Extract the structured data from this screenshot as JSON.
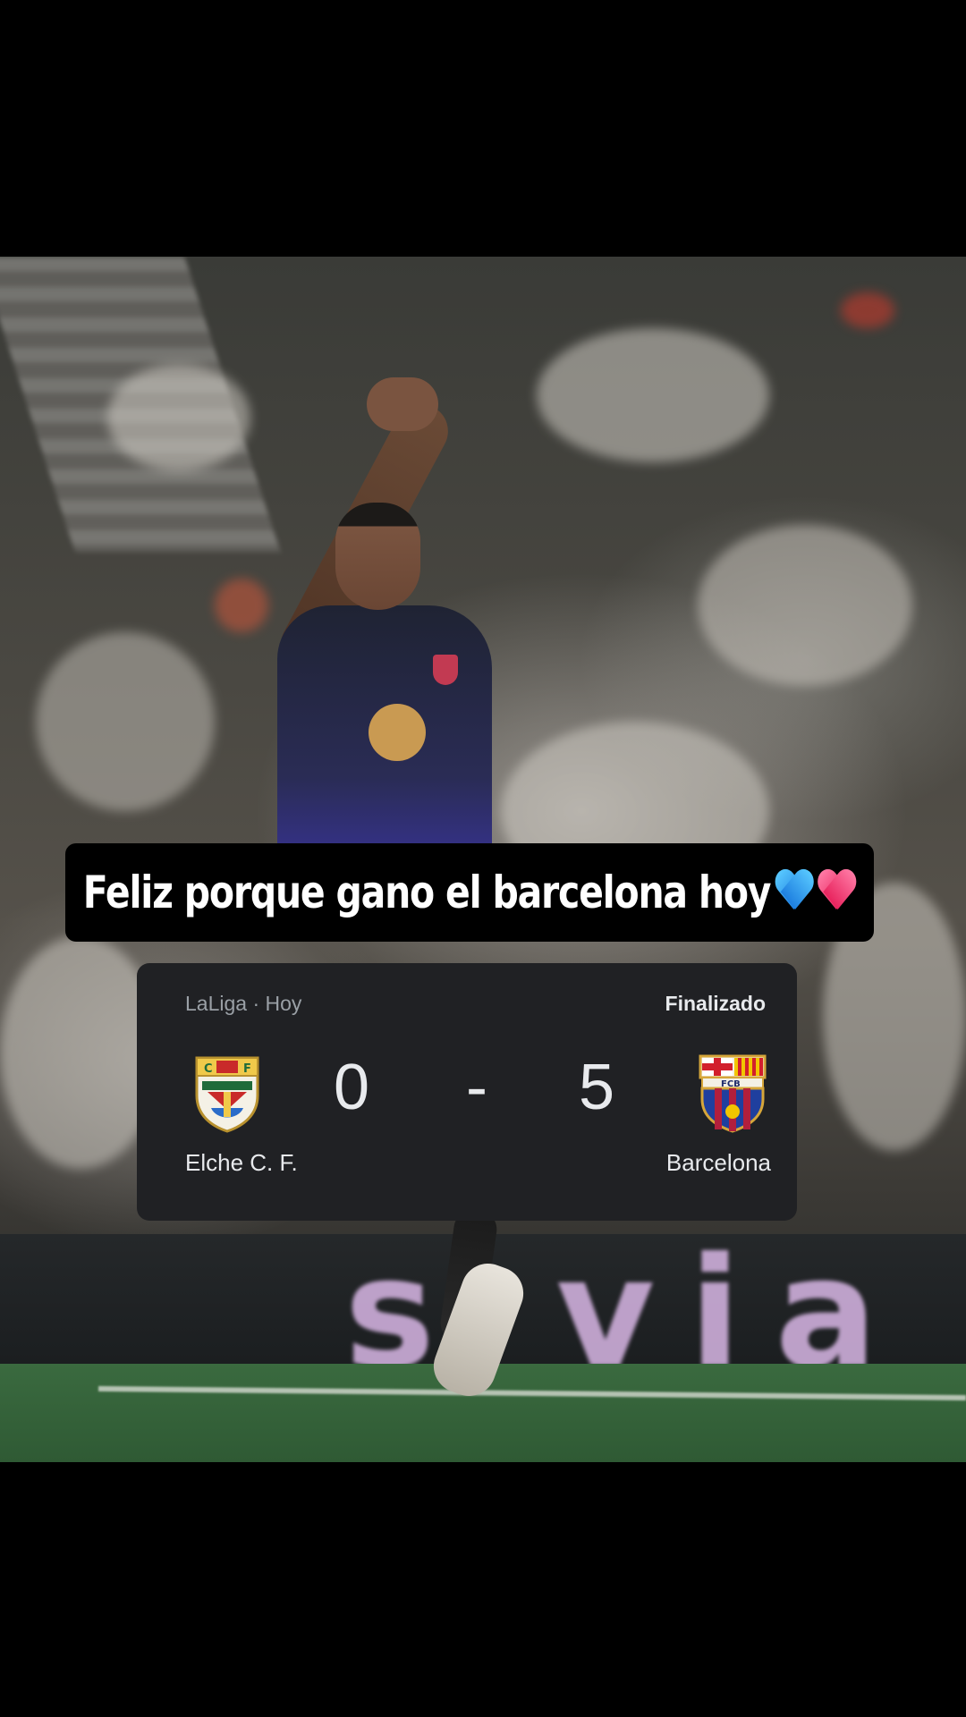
{
  "caption": {
    "text": "Feliz porque gano el barcelona hoy",
    "emojis": [
      "blue-heart",
      "pink-heart"
    ]
  },
  "scorecard": {
    "league": "LaLiga · Hoy",
    "status": "Finalizado",
    "home": {
      "name": "Elche C. F.",
      "score": "0",
      "crest": "elche-crest-icon"
    },
    "separator": "-",
    "away": {
      "name": "Barcelona",
      "score": "5",
      "crest": "barcelona-crest-icon"
    }
  },
  "background": {
    "ad_board_text": "s via"
  },
  "colors": {
    "card_bg": "#202124",
    "card_text": "#e8eaed",
    "muted_text": "#9aa0a6",
    "caption_bg": "#000000"
  }
}
